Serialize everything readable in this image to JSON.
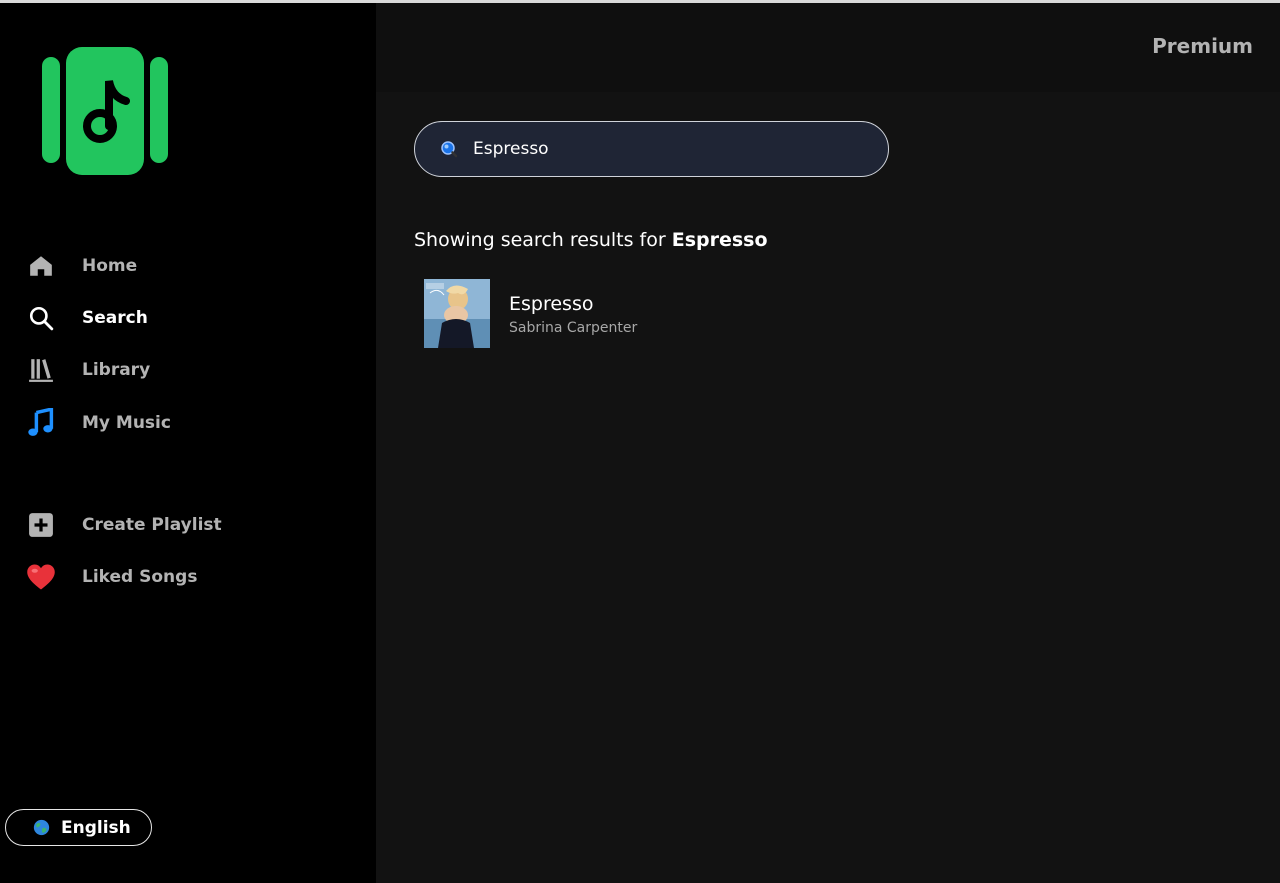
{
  "app": {
    "brand_color": "#1db954"
  },
  "sidebar": {
    "items": [
      {
        "label": "Home",
        "icon": "home-icon",
        "active": false
      },
      {
        "label": "Search",
        "icon": "search-icon",
        "active": true
      },
      {
        "label": "Library",
        "icon": "library-icon",
        "active": false
      },
      {
        "label": "My Music",
        "icon": "music-note-icon",
        "active": false
      },
      {
        "label": "Create Playlist",
        "icon": "plus-square-icon",
        "active": false
      },
      {
        "label": "Liked Songs",
        "icon": "heart-icon",
        "active": false
      }
    ],
    "language": "English"
  },
  "header": {
    "premium_label": "Premium"
  },
  "search": {
    "value": "Espresso",
    "heading_prefix": "Showing search results for",
    "heading_query": "Espresso"
  },
  "results": [
    {
      "title": "Espresso",
      "artist": "Sabrina Carpenter"
    }
  ],
  "colors": {
    "sidebar_bg": "#000000",
    "main_bg": "#121212",
    "search_bg": "#1f2535",
    "accent_blue": "#1e90ff",
    "heart": "#e8323a"
  }
}
